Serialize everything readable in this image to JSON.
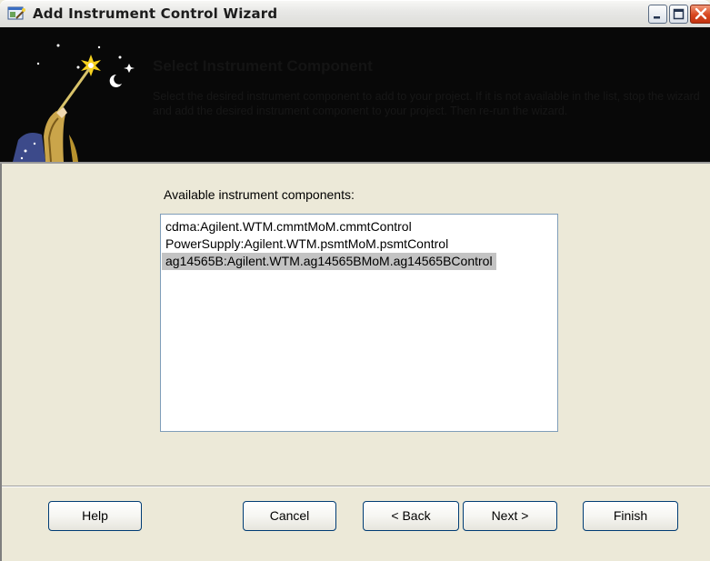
{
  "window": {
    "title": "Add Instrument Control Wizard"
  },
  "banner": {
    "title": "Select Instrument Component",
    "description": "Select the desired instrument component to add to your project.  If it is not available in the list, stop the wizard and add the desired instrument component to your project. Then re-run the wizard."
  },
  "list": {
    "label": "Available instrument components:",
    "items": [
      "cdma:Agilent.WTM.cmmtMoM.cmmtControl",
      "PowerSupply:Agilent.WTM.psmtMoM.psmtControl",
      "ag14565B:Agilent.WTM.ag14565BMoM.ag14565BControl"
    ],
    "selected_item": "ag14565B:Agilent.WTM.ag14565BMoM.ag14565BControl"
  },
  "buttons": {
    "help": "Help",
    "cancel": "Cancel",
    "back": "< Back",
    "next": "Next >",
    "finish": "Finish"
  },
  "icons": {
    "app": "wizard-app-icon",
    "minimize": "minimize-icon",
    "maximize": "maximize-icon",
    "close": "close-icon",
    "banner_art": "wizard-with-wand-icon"
  },
  "colors": {
    "banner_background": "#080808",
    "selection_highlight": "#c3c3c3",
    "close_button": "#d8471f",
    "dialog_background": "#ece9d8"
  }
}
